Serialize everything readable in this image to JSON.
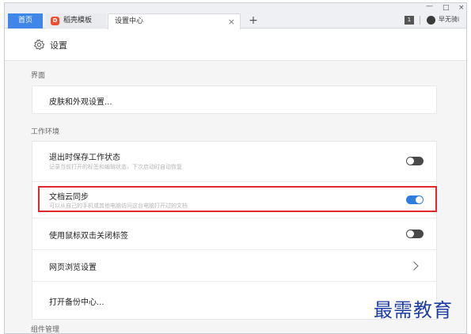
{
  "tabs": {
    "home": "首页",
    "template": "稻壳模板",
    "active": "设置中心",
    "close_glyph": "×",
    "new_tab_glyph": "+"
  },
  "window_controls": {
    "minimize": "—",
    "maximize": "□",
    "close": "×"
  },
  "toolbar": {
    "icon_text": "1",
    "username": "早无骑i"
  },
  "header": {
    "title": "设置"
  },
  "sections": {
    "interface": {
      "label": "界面",
      "skin_item": "皮肤和外观设置..."
    },
    "work_env": {
      "label": "工作环境",
      "save_state": {
        "title": "退出时保存工作状态",
        "desc": "记录当前打开的标签和编辑状态，下次启动时自动恢复",
        "enabled": false
      },
      "cloud_sync": {
        "title": "文档云同步",
        "desc": "可以从自己的手机或其他电脑访问这台电脑打开过的文档",
        "enabled": true
      },
      "dblclick_close": {
        "title": "使用鼠标双击关闭标签",
        "enabled": false
      },
      "web_browse": {
        "title": "网页浏览设置"
      },
      "backup": {
        "title": "打开备份中心..."
      }
    },
    "components": {
      "label": "组件管理"
    }
  },
  "watermark": "最需教育",
  "colors": {
    "accent": "#2f7de1",
    "highlight": "#e0282e",
    "home_tab": "#3f86e8",
    "watermark": "#1e3ea8"
  }
}
